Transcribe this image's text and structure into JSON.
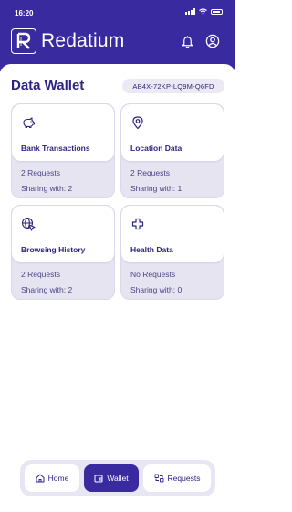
{
  "status": {
    "time": "16:20"
  },
  "app": {
    "name": "Redatium"
  },
  "page": {
    "title": "Data Wallet",
    "wallet_id": "AB4X-72KP-LQ9M-Q6FD"
  },
  "cards": [
    {
      "label": "Bank Transactions",
      "requests": "2 Requests",
      "sharing": "Sharing with: 2",
      "icon": "piggy-bank-icon"
    },
    {
      "label": "Location Data",
      "requests": "2 Requests",
      "sharing": "Sharing with: 1",
      "icon": "location-pin-icon"
    },
    {
      "label": "Browsing History",
      "requests": "2 Requests",
      "sharing": "Sharing with: 2",
      "icon": "globe-cursor-icon"
    },
    {
      "label": "Health Data",
      "requests": "No Requests",
      "sharing": "Sharing with: 0",
      "icon": "medical-cross-icon"
    }
  ],
  "nav": {
    "home": "Home",
    "wallet": "Wallet",
    "requests": "Requests"
  },
  "colors": {
    "primary": "#3a2aa0",
    "card_bg": "#e7e4f2",
    "text": "#2b2480"
  }
}
